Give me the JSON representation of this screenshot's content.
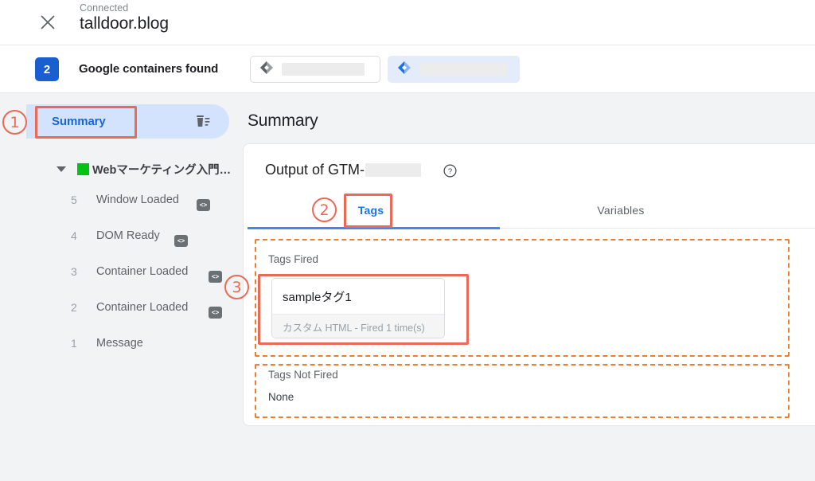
{
  "topbar": {
    "close_icon": "close-icon",
    "connection_status": "Connected",
    "domain": "talldoor.blog"
  },
  "containers": {
    "count": "2",
    "found_label": "Google containers found",
    "chips": [
      {
        "icon": "gtm-diamond-icon-grey",
        "label": ""
      },
      {
        "icon": "gtm-diamond-icon-blue",
        "label": ""
      }
    ]
  },
  "sidebar": {
    "summary_label": "Summary",
    "clear_icon": "delete-sweep-icon",
    "tree": {
      "caret_icon": "caret-down-icon",
      "status_color": "#00c411",
      "name": "Webマーケティング入門…"
    },
    "events": [
      {
        "num": "5",
        "label": "Window Loaded",
        "icon": "code-icon"
      },
      {
        "num": "4",
        "label": "DOM Ready",
        "icon": "code-icon"
      },
      {
        "num": "3",
        "label": "Container Loaded",
        "icon": "code-icon"
      },
      {
        "num": "2",
        "label": "Container Loaded",
        "icon": "code-icon"
      },
      {
        "num": "1",
        "label": "Message",
        "icon": ""
      }
    ]
  },
  "main": {
    "title": "Summary",
    "output_prefix": "Output of GTM-",
    "help_icon": "help-circle-icon",
    "tabs": [
      {
        "label": "Tags",
        "active": true
      },
      {
        "label": "Variables",
        "active": false
      }
    ],
    "tags_fired": {
      "title": "Tags Fired",
      "items": [
        {
          "name": "sampleタグ1",
          "meta": "カスタム HTML - Fired 1 time(s)"
        }
      ]
    },
    "tags_not_fired": {
      "title": "Tags Not Fired",
      "value": "None"
    }
  },
  "annotations": {
    "markers": [
      {
        "num": "①",
        "target": "summary-sidebar-item"
      },
      {
        "num": "②",
        "target": "tab-tags"
      },
      {
        "num": "③",
        "target": "fired-tag-card"
      }
    ],
    "color": "#eb6a55"
  }
}
